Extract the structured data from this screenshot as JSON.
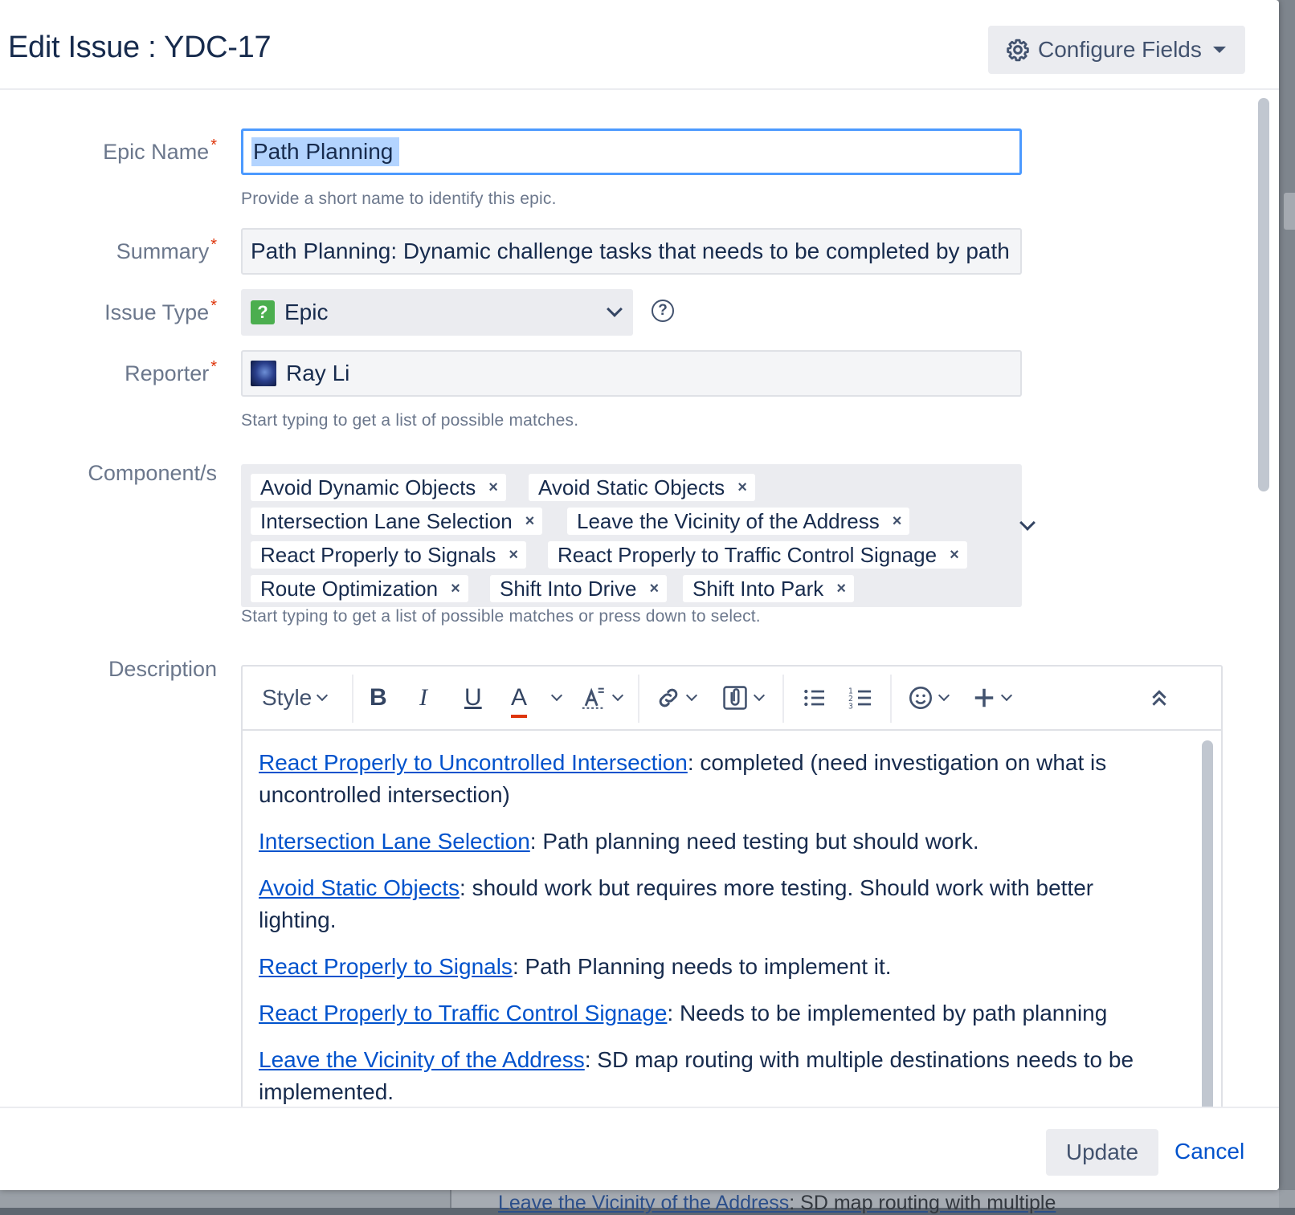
{
  "dialog": {
    "title": "Edit Issue : YDC-17",
    "configure_fields_label": "Configure Fields"
  },
  "fields": {
    "epic_name": {
      "label": "Epic Name",
      "value": "Path Planning",
      "help": "Provide a short name to identify this epic."
    },
    "summary": {
      "label": "Summary",
      "value": "Path Planning: Dynamic challenge tasks that needs to be completed by path"
    },
    "issue_type": {
      "label": "Issue Type",
      "value": "Epic",
      "icon": "question-mark-icon"
    },
    "reporter": {
      "label": "Reporter",
      "value": "Ray Li",
      "help": "Start typing to get a list of possible matches."
    },
    "components": {
      "label": "Component/s",
      "chips": [
        "Avoid Dynamic Objects",
        "Avoid Static Objects",
        "Intersection Lane Selection",
        "Leave the Vicinity of the Address",
        "React Properly to Signals",
        "React Properly to Traffic Control Signage",
        "Route Optimization",
        "Shift Into Drive",
        "Shift Into Park"
      ],
      "remove_glyph": "×",
      "help": "Start typing to get a list of possible matches or press down to select."
    },
    "description": {
      "label": "Description",
      "toolbar": {
        "style_label": "Style",
        "bold": "B",
        "italic": "I",
        "underline": "U",
        "text_color": "A"
      },
      "paragraphs": [
        {
          "link": "React Properly to Uncontrolled Intersection",
          "text": ": completed (need investigation on what is uncontrolled intersection)"
        },
        {
          "link": "Intersection Lane Selection",
          "text": ": Path planning need testing but should work."
        },
        {
          "link": "Avoid Static Objects",
          "text": ": should work but requires more testing.  Should work with better lighting."
        },
        {
          "link": "React Properly to Signals",
          "text": ": Path Planning needs to implement it."
        },
        {
          "link": "React Properly to Traffic Control Signage",
          "text": ": Needs to be implemented by path planning"
        },
        {
          "link": "Leave the Vicinity of the Address",
          "text": ":  SD map routing with multiple destinations needs to be implemented."
        }
      ]
    }
  },
  "footer": {
    "update_label": "Update",
    "cancel_label": "Cancel"
  },
  "background": {
    "link": "Leave the Vicinity of the Address",
    "text": ":  SD map routing with multiple"
  },
  "colors": {
    "required": "#de350b",
    "link": "#0052cc",
    "focus": "#4c9aff",
    "epic_icon": "#4bae4f"
  }
}
